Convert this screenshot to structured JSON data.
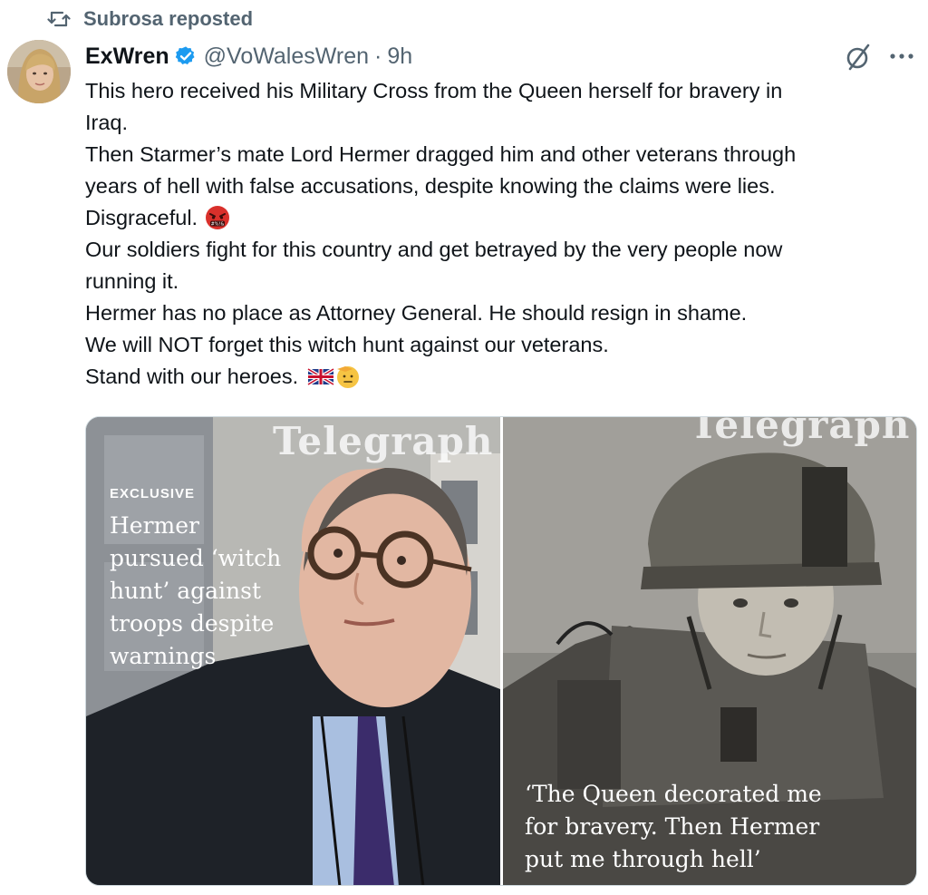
{
  "repost": {
    "label": "Subrosa reposted"
  },
  "author": {
    "name": "ExWren",
    "handle": "@VoWalesWren",
    "separator": "·",
    "time": "9h"
  },
  "tweet": {
    "lines": [
      "This hero received his Military Cross from the Queen herself for bravery in",
      "Iraq.",
      "Then Starmer’s mate Lord Hermer dragged him and other veterans through",
      "years of hell with false accusations, despite knowing the claims were lies.",
      "Disgraceful.",
      "Our soldiers fight for this country and get betrayed by the very people now",
      "running it.",
      "Hermer has no place as Attorney General. He should resign in shame.",
      "We will NOT forget this witch hunt against our veterans.",
      "Stand with our heroes."
    ],
    "emojis": {
      "line5": "angry-cursing-face-emoji",
      "line10": [
        "uk-flag-emoji",
        "saluting-face-emoji"
      ]
    }
  },
  "media": {
    "left": {
      "masthead": "Telegraph",
      "kicker": "EXCLUSIVE",
      "headline_lines": [
        "Hermer",
        "pursued ‘witch",
        "hunt’ against",
        "troops despite",
        "warnings"
      ]
    },
    "right": {
      "masthead": "Telegraph",
      "quote_lines": [
        "‘The Queen decorated me",
        "for bravery. Then Hermer",
        "put me through hell’"
      ]
    }
  },
  "colors": {
    "text": "#0f1419",
    "secondary": "#536471",
    "verified": "#1d9bf0"
  },
  "icons": {
    "repost": "repost-icon",
    "verified": "verified-badge-icon",
    "grok": "grok-icon",
    "more": "more-icon"
  }
}
